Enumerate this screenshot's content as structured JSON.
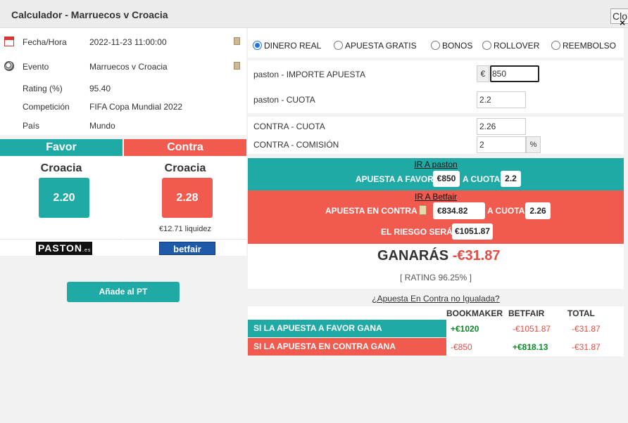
{
  "dialog": {
    "title": "Calculador - Marruecos v Croacia",
    "close_label": "Clo",
    "close_icon": "×"
  },
  "event_info": {
    "datetime_label": "Fecha/Hora",
    "datetime_value": "2022-11-23 11:00:00",
    "event_label": "Evento",
    "event_value": "Marruecos v Croacia",
    "rating_label": "Rating (%)",
    "rating_value": "95.40",
    "competition_label": "Competición",
    "competition_value": "FIFA Copa Mundial 2022",
    "country_label": "País",
    "country_value": "Mundo"
  },
  "favor": {
    "header": "Favor",
    "team": "Croacia",
    "odds": "2.20",
    "bookmaker_logo": "PASTON",
    "bookmaker_logo_suffix": ".es",
    "color": "#20aaa6"
  },
  "contra": {
    "header": "Contra",
    "team": "Croacia",
    "odds": "2.28",
    "liquidity": "€12.71 liquidez",
    "exchange_logo": "betfair",
    "color": "#f05a4f"
  },
  "add_button_label": "Añade al PT",
  "bet_types": [
    {
      "label": "DINERO REAL",
      "checked": true
    },
    {
      "label": "APUESTA GRATIS",
      "checked": false
    },
    {
      "label": "BONOS",
      "checked": false
    },
    {
      "label": "ROLLOVER",
      "checked": false
    },
    {
      "label": "REEMBOLSO",
      "checked": false
    }
  ],
  "form": {
    "stake_label": "paston - IMPORTE APUESTA",
    "stake_currency": "€",
    "stake_value": "850",
    "odds_label": "paston - CUOTA",
    "odds_value": "2.2",
    "lay_odds_label": "CONTRA - CUOTA",
    "lay_odds_value": "2.26",
    "commission_label": "CONTRA - COMISIÓN",
    "commission_value": "2",
    "commission_unit": "%"
  },
  "instructions": {
    "back_link": "IR A paston",
    "back_text": "APUESTA A FAVOR",
    "back_amount": "€850",
    "back_odds_text": "A CUOTA",
    "back_odds": "2.2",
    "lay_link": "IR A Betfair",
    "lay_text": "APUESTA EN CONTRA",
    "lay_amount": "€834.82",
    "lay_odds_text": "A CUOTA",
    "lay_odds": "2.26",
    "risk_text": "EL RIESGO SERÁ",
    "risk_amount": "€1051.87"
  },
  "result": {
    "profit_label": "GANARÁS",
    "profit_value": "-€31.87",
    "rating_text": "[ RATING 96.25% ]"
  },
  "unmatched_link": "¿Apuesta En Contra no Igualada?",
  "summary": {
    "headers": [
      "BOOKMAKER",
      "BETFAIR",
      "TOTAL"
    ],
    "rows": [
      {
        "label": "SI LA APUESTA A FAVOR GANA",
        "bookmaker": "+€1020",
        "betfair": "-€1051.87",
        "total": "-€31.87"
      },
      {
        "label": "SI LA APUESTA EN CONTRA GANA",
        "bookmaker": "-€850",
        "betfair": "+€818.13",
        "total": "-€31.87"
      }
    ]
  }
}
